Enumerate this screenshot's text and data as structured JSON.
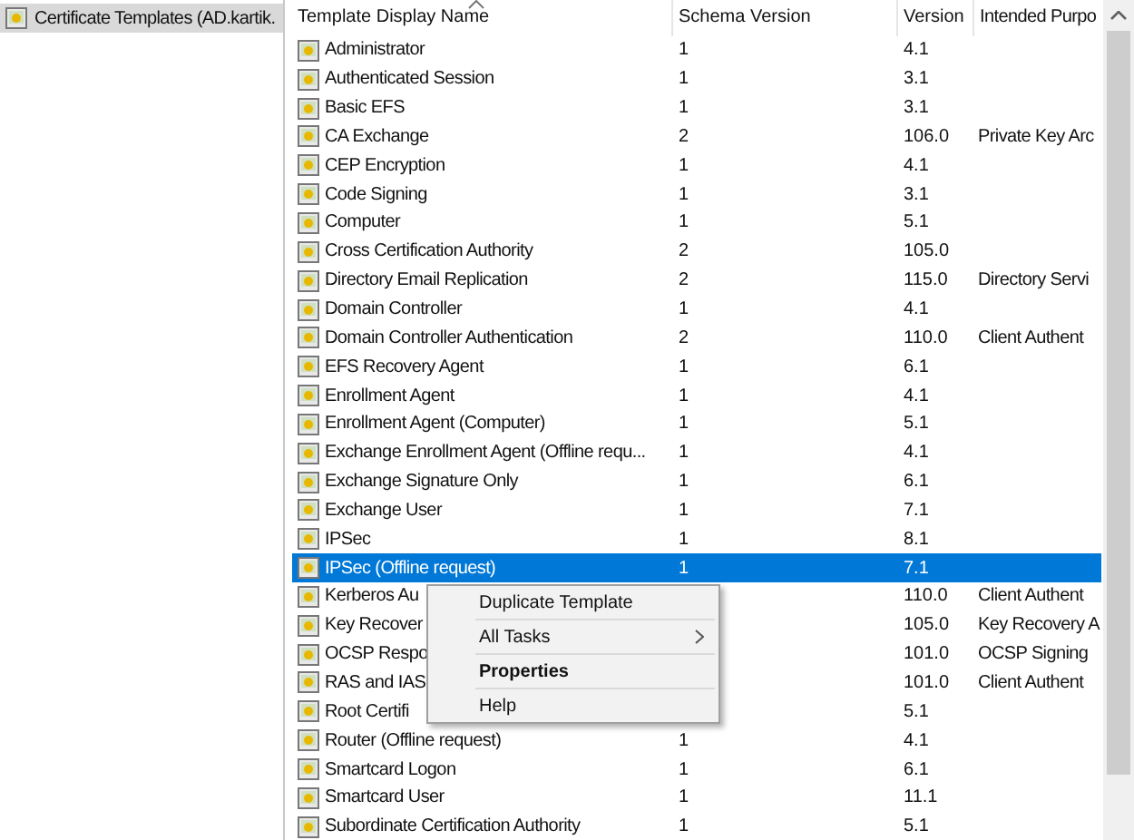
{
  "tree": {
    "items": [
      {
        "label": "Certificate Templates (AD.kartik.",
        "selected": true
      }
    ]
  },
  "table": {
    "columns": [
      {
        "label": "Template Display Name",
        "sorted": true
      },
      {
        "label": "Schema Version",
        "sorted": false
      },
      {
        "label": "Version",
        "sorted": false
      },
      {
        "label": "Intended Purpo",
        "sorted": false
      }
    ],
    "rows": [
      {
        "name": "Administrator",
        "schema": "1",
        "version": "4.1",
        "selected": false
      },
      {
        "name": "Authenticated Session",
        "schema": "1",
        "version": "3.1",
        "selected": false
      },
      {
        "name": "Basic EFS",
        "schema": "1",
        "version": "3.1",
        "selected": false
      },
      {
        "name": "CA Exchange",
        "schema": "2",
        "version": "106.0",
        "purpose": "Private Key Arc",
        "selected": false
      },
      {
        "name": "CEP Encryption",
        "schema": "1",
        "version": "4.1",
        "selected": false
      },
      {
        "name": "Code Signing",
        "schema": "1",
        "version": "3.1",
        "selected": false
      },
      {
        "name": "Computer",
        "schema": "1",
        "version": "5.1",
        "selected": false
      },
      {
        "name": "Cross Certification Authority",
        "schema": "2",
        "version": "105.0",
        "selected": false
      },
      {
        "name": "Directory Email Replication",
        "schema": "2",
        "version": "115.0",
        "purpose": "Directory Servi",
        "selected": false
      },
      {
        "name": "Domain Controller",
        "schema": "1",
        "version": "4.1",
        "selected": false
      },
      {
        "name": "Domain Controller Authentication",
        "schema": "2",
        "version": "110.0",
        "purpose": "Client Authent",
        "selected": false
      },
      {
        "name": "EFS Recovery Agent",
        "schema": "1",
        "version": "6.1",
        "selected": false
      },
      {
        "name": "Enrollment Agent",
        "schema": "1",
        "version": "4.1",
        "selected": false
      },
      {
        "name": "Enrollment Agent (Computer)",
        "schema": "1",
        "version": "5.1",
        "selected": false
      },
      {
        "name": "Exchange Enrollment Agent (Offline requ...",
        "schema": "1",
        "version": "4.1",
        "selected": false
      },
      {
        "name": "Exchange Signature Only",
        "schema": "1",
        "version": "6.1",
        "selected": false
      },
      {
        "name": "Exchange User",
        "schema": "1",
        "version": "7.1",
        "selected": false
      },
      {
        "name": "IPSec",
        "schema": "1",
        "version": "8.1",
        "selected": false
      },
      {
        "name": "IPSec (Offline request)",
        "schema": "1",
        "version": "7.1",
        "selected": true
      },
      {
        "name": "Kerberos Au",
        "version": "110.0",
        "purpose": "Client Authent",
        "selected": false
      },
      {
        "name": "Key Recover",
        "version": "105.0",
        "purpose": "Key Recovery A",
        "selected": false
      },
      {
        "name": "OCSP Respo",
        "version": "101.0",
        "purpose": "OCSP Signing",
        "selected": false
      },
      {
        "name": "RAS and IAS",
        "version": "101.0",
        "purpose": "Client Authent",
        "selected": false
      },
      {
        "name": "Root Certifi",
        "version": "5.1",
        "selected": false
      },
      {
        "name": "Router (Offline request)",
        "schema": "1",
        "version": "4.1",
        "selected": false
      },
      {
        "name": "Smartcard Logon",
        "schema": "1",
        "version": "6.1",
        "selected": false
      },
      {
        "name": "Smartcard User",
        "schema": "1",
        "version": "11.1",
        "selected": false
      },
      {
        "name": "Subordinate Certification Authority",
        "schema": "1",
        "version": "5.1",
        "selected": false
      }
    ]
  },
  "context_menu": {
    "items": [
      {
        "label": "Duplicate Template",
        "bold": false,
        "submenu": false
      },
      {
        "label": "All Tasks",
        "bold": false,
        "submenu": true
      },
      {
        "label": "Properties",
        "bold": true,
        "submenu": false
      },
      {
        "label": "Help",
        "bold": false,
        "submenu": false
      }
    ]
  }
}
